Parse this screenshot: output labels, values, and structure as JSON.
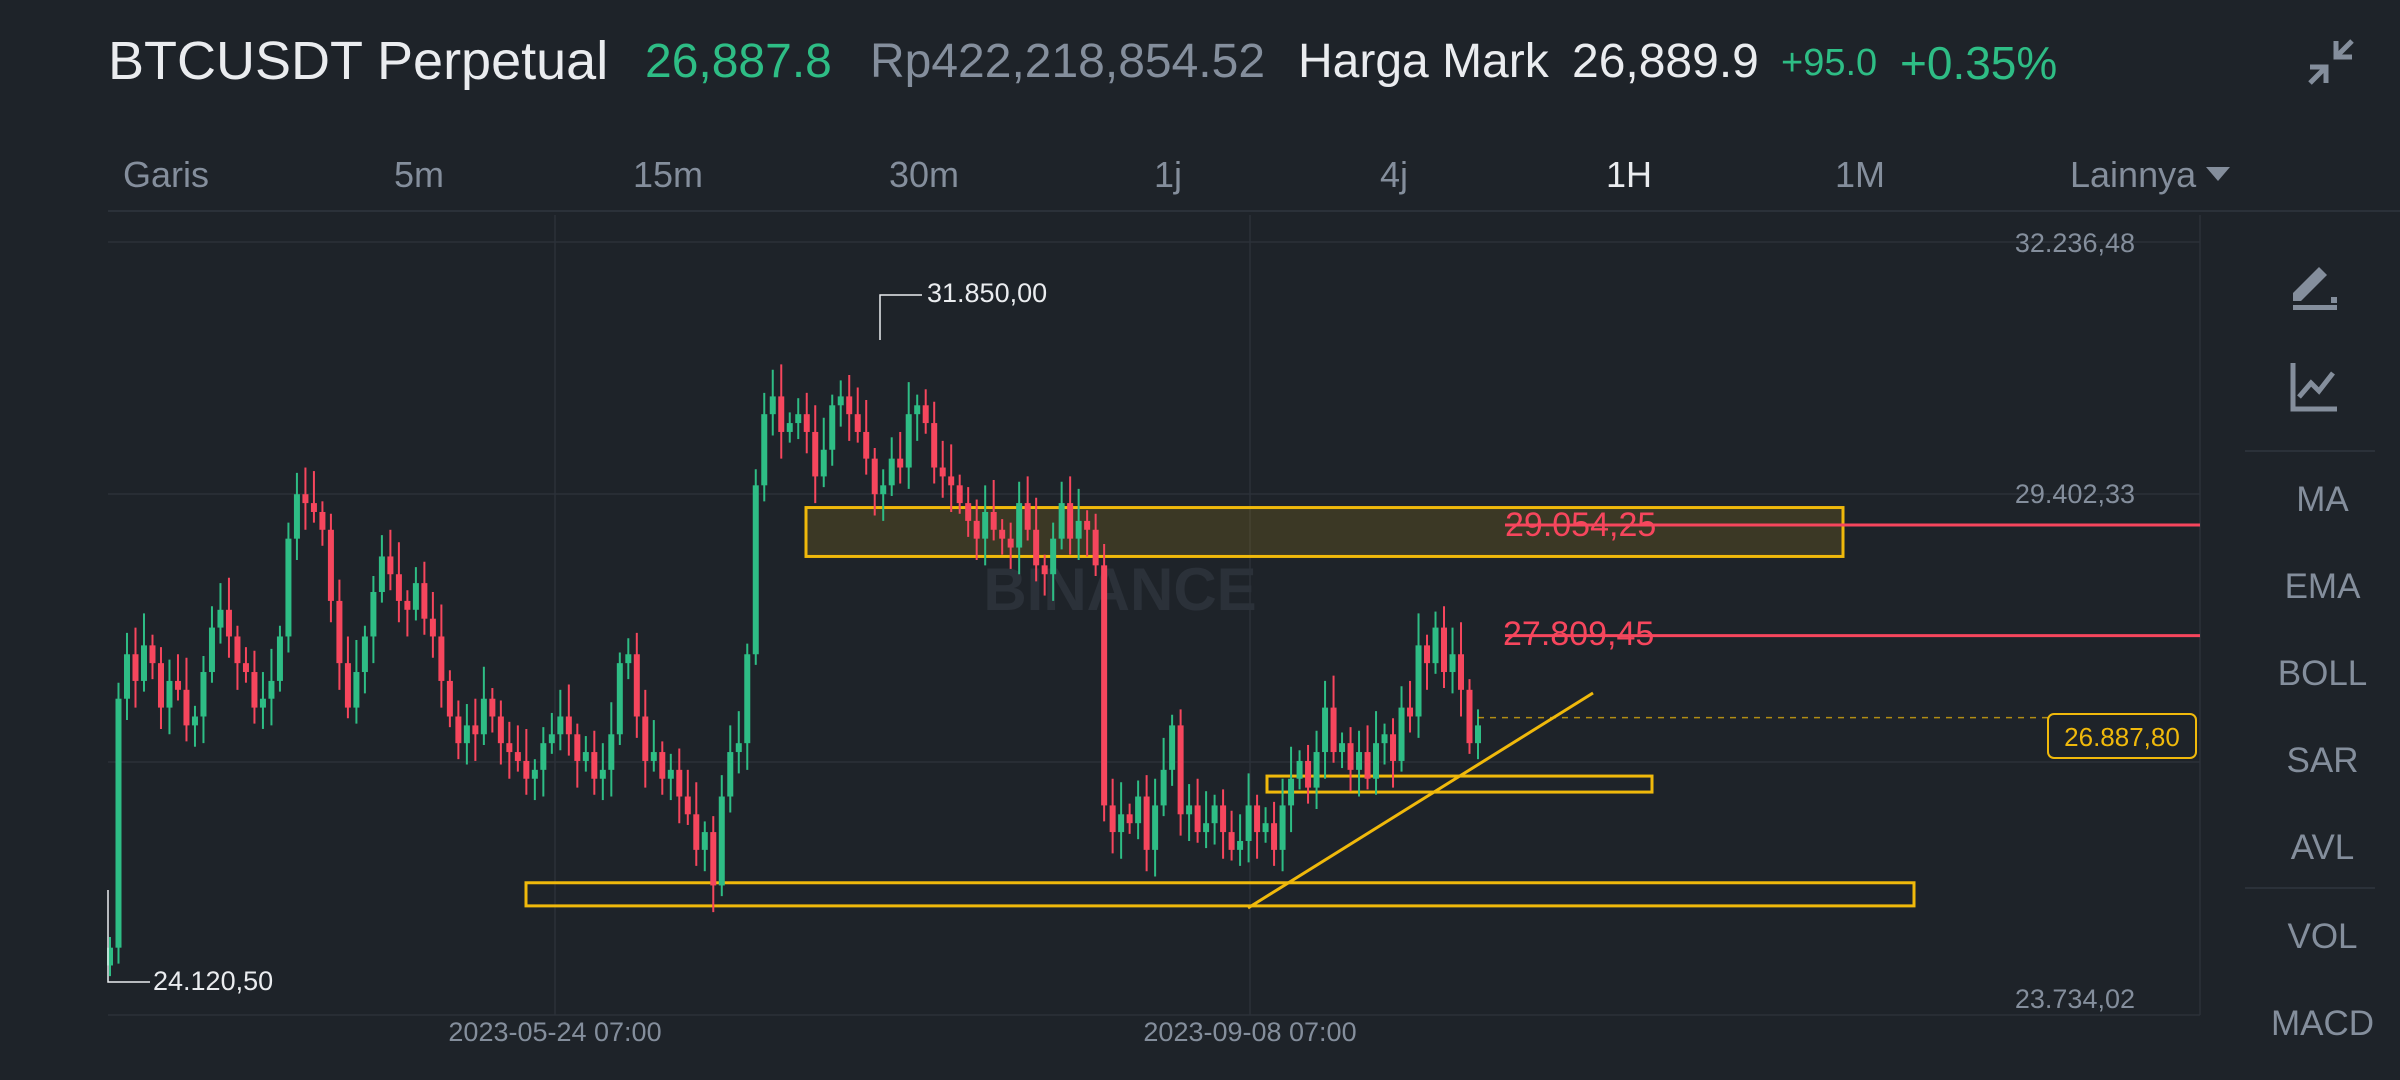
{
  "header": {
    "pair": "BTCUSDT Perpetual",
    "last_price": "26,887.8",
    "fiat_price": "Rp422,218,854.52",
    "mark_label": "Harga Mark",
    "mark_price": "26,889.9",
    "change_abs": "+95.0",
    "change_pct": "+0.35%",
    "collapse_icon": "collapse-icon"
  },
  "tabs": [
    {
      "label": "Garis",
      "active": false
    },
    {
      "label": "5m",
      "active": false
    },
    {
      "label": "15m",
      "active": false
    },
    {
      "label": "30m",
      "active": false
    },
    {
      "label": "1j",
      "active": false
    },
    {
      "label": "4j",
      "active": false
    },
    {
      "label": "1H",
      "active": true
    },
    {
      "label": "1M",
      "active": false
    },
    {
      "label": "Lainnya",
      "active": false
    }
  ],
  "toolbar": {
    "draw_icon": "pencil-icon",
    "indicator_icon": "chart-line-icon",
    "indicators": [
      "MA",
      "EMA",
      "BOLL",
      "SAR",
      "AVL"
    ],
    "sub_indicators": [
      "VOL",
      "MACD"
    ]
  },
  "chart_data": {
    "type": "candlestick",
    "watermark": "BINANCE",
    "y_axis_labels": [
      "32.236,48",
      "29.402,33",
      "23.734,02"
    ],
    "x_axis_labels": [
      "2023-05-24 07:00",
      "2023-09-08 07:00"
    ],
    "ylim": [
      23734.02,
      32236.48
    ],
    "high_marker": "31.850,00",
    "low_marker": "24.120,50",
    "current_price": "26.887,80",
    "price_lines": [
      {
        "label": "29.054,25",
        "value": 29054.25,
        "color": "#f6465d"
      },
      {
        "label": "27.809,45",
        "value": 27809.45,
        "color": "#f6465d"
      }
    ],
    "zones": [
      {
        "low": 28700,
        "high": 29250,
        "filled": true
      },
      {
        "low": 26050,
        "high": 26230,
        "filled": false
      },
      {
        "low": 24770,
        "high": 25030,
        "filled": false
      }
    ],
    "colors": {
      "up": "#2ebd85",
      "down": "#f6465d",
      "zone": "#f0b90b"
    },
    "closes": [
      24300,
      27100,
      27600,
      27300,
      27700,
      27500,
      27000,
      27300,
      27200,
      26800,
      26900,
      27400,
      27900,
      28100,
      27800,
      27500,
      27400,
      27000,
      27100,
      27300,
      27800,
      28900,
      29400,
      29300,
      29200,
      29000,
      28200,
      27500,
      27000,
      27400,
      27800,
      28300,
      28700,
      28500,
      28200,
      28100,
      28400,
      28000,
      27800,
      27300,
      26900,
      26600,
      26800,
      26700,
      27100,
      26900,
      26600,
      26500,
      26400,
      26200,
      26300,
      26600,
      26700,
      26900,
      26700,
      26400,
      26500,
      26200,
      26300,
      26700,
      27500,
      27600,
      26900,
      26400,
      26500,
      26200,
      26300,
      26000,
      25800,
      25400,
      25600,
      25000,
      26000,
      26500,
      26600,
      27600,
      29500,
      30300,
      30500,
      30100,
      30200,
      30300,
      30100,
      29600,
      29900,
      30400,
      30500,
      30300,
      30100,
      29800,
      29400,
      29500,
      29800,
      29700,
      30300,
      30400,
      30200,
      29700,
      29600,
      29500,
      29300,
      29100,
      28900,
      29200,
      29000,
      28900,
      28800,
      29300,
      29000,
      28600,
      28500,
      28900,
      29300,
      28900,
      29100,
      29000,
      28600,
      25900,
      25600,
      25800,
      25700,
      26000,
      25400,
      25900,
      26300,
      26800,
      25800,
      25900,
      25600,
      25700,
      25900,
      25600,
      25400,
      25500,
      25900,
      25600,
      25700,
      25400,
      25900,
      26200,
      26400,
      26100,
      26500,
      27000,
      26500,
      26600,
      26300,
      26500,
      26200,
      26600,
      26700,
      26400,
      27000,
      26900,
      27700,
      27500,
      27900,
      27400,
      27600,
      27200,
      26600,
      26800
    ]
  }
}
